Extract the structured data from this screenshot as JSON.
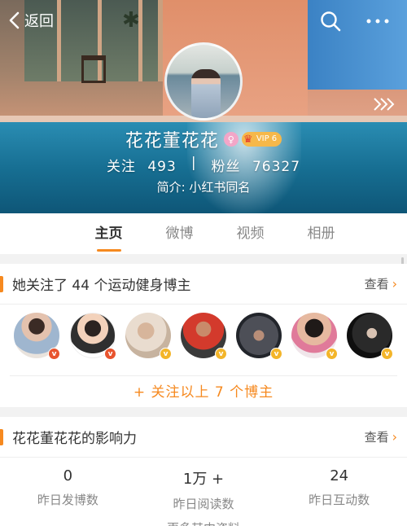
{
  "nav": {
    "back_label": "返回"
  },
  "profile": {
    "username": "花花董花花",
    "female_badge": "♀",
    "vip_label": "VIP 6",
    "following_label": "关注",
    "following_count": "493",
    "separator": "|",
    "fans_label": "粉丝",
    "fans_count": "76327",
    "intro": "简介: 小红书同名"
  },
  "tabs": [
    {
      "label": "主页",
      "active": true
    },
    {
      "label": "微博",
      "active": false
    },
    {
      "label": "视频",
      "active": false
    },
    {
      "label": "相册",
      "active": false
    }
  ],
  "follow_section": {
    "title": "她关注了 44 个运动健身博主",
    "view_more": "查看",
    "follow_all": "+ 关注以上 7 个博主",
    "avatars": [
      {
        "badge": "v",
        "badge_color": "red"
      },
      {
        "badge": "v",
        "badge_color": "red"
      },
      {
        "badge": "v",
        "badge_color": "gold"
      },
      {
        "badge": "v",
        "badge_color": "gold"
      },
      {
        "badge": "v",
        "badge_color": "gold"
      },
      {
        "badge": "v",
        "badge_color": "gold"
      },
      {
        "badge": "v",
        "badge_color": "gold"
      }
    ]
  },
  "influence": {
    "title": "花花董花花的影响力",
    "view_more": "查看",
    "metrics": [
      {
        "value": "0",
        "label": "昨日发博数"
      },
      {
        "value": "1万 +",
        "label": "昨日阅读数"
      },
      {
        "value": "24",
        "label": "昨日互动数"
      }
    ],
    "more_data": "更多其中资料"
  },
  "colors": {
    "accent": "#f6891f",
    "badge_red": "#e8542e",
    "badge_gold": "#f3b52a"
  }
}
